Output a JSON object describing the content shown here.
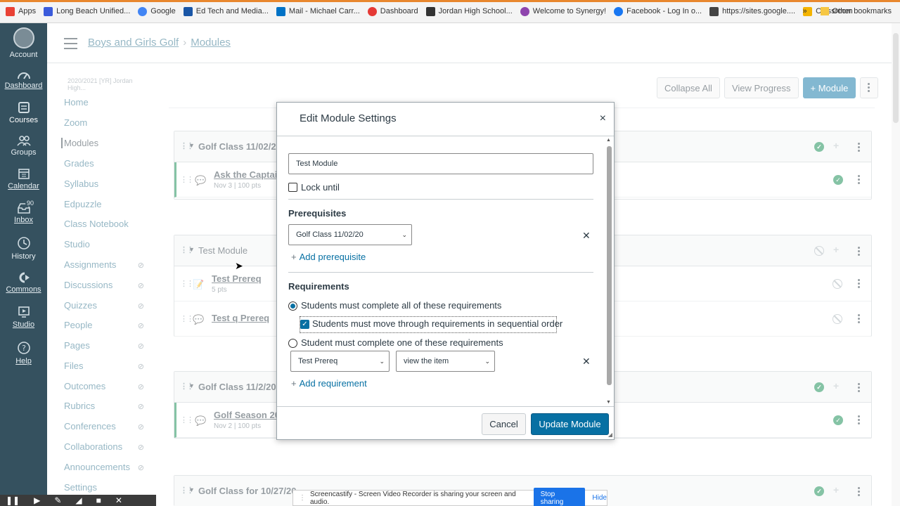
{
  "bookmarks": {
    "items": [
      {
        "label": "Apps",
        "color": "#e94235"
      },
      {
        "label": "Long Beach Unified...",
        "color": "#3b5bdb"
      },
      {
        "label": "Google",
        "color": "#4285f4"
      },
      {
        "label": "Ed Tech and Media...",
        "color": "#1a56a6"
      },
      {
        "label": "Mail - Michael Carr...",
        "color": "#0072c6"
      },
      {
        "label": "Dashboard",
        "color": "#e53935"
      },
      {
        "label": "Jordan High School...",
        "color": "#333333"
      },
      {
        "label": "Welcome to Synergy!",
        "color": "#8e44ad"
      },
      {
        "label": "Facebook - Log In o...",
        "color": "#1877f2"
      },
      {
        "label": "https://sites.google....",
        "color": "#444444"
      },
      {
        "label": "Classroom",
        "color": "#f4b400"
      }
    ],
    "more": "»",
    "other": "Other bookmarks"
  },
  "global_nav": {
    "items": [
      {
        "label": "Account"
      },
      {
        "label": "Dashboard"
      },
      {
        "label": "Courses"
      },
      {
        "label": "Groups"
      },
      {
        "label": "Calendar"
      },
      {
        "label": "Inbox",
        "badge": "90"
      },
      {
        "label": "History"
      },
      {
        "label": "Commons"
      },
      {
        "label": "Studio"
      },
      {
        "label": "Help"
      }
    ]
  },
  "breadcrumb": {
    "course": "Boys and Girls Golf",
    "page": "Modules"
  },
  "course_nav": {
    "term": "2020/2021 [YR] Jordan High...",
    "items": [
      {
        "label": "Home",
        "hidden": false
      },
      {
        "label": "Zoom",
        "hidden": false
      },
      {
        "label": "Modules",
        "hidden": false
      },
      {
        "label": "Grades",
        "hidden": false
      },
      {
        "label": "Syllabus",
        "hidden": false
      },
      {
        "label": "Edpuzzle",
        "hidden": false
      },
      {
        "label": "Class Notebook",
        "hidden": false
      },
      {
        "label": "Studio",
        "hidden": false
      },
      {
        "label": "Assignments",
        "hidden": true
      },
      {
        "label": "Discussions",
        "hidden": true
      },
      {
        "label": "Quizzes",
        "hidden": true
      },
      {
        "label": "People",
        "hidden": true
      },
      {
        "label": "Pages",
        "hidden": true
      },
      {
        "label": "Files",
        "hidden": true
      },
      {
        "label": "Outcomes",
        "hidden": true
      },
      {
        "label": "Rubrics",
        "hidden": true
      },
      {
        "label": "Conferences",
        "hidden": true
      },
      {
        "label": "Collaborations",
        "hidden": true
      },
      {
        "label": "Announcements",
        "hidden": true
      },
      {
        "label": "Settings",
        "hidden": false
      }
    ]
  },
  "toolbar": {
    "collapse_all": "Collapse All",
    "view_progress": "View Progress",
    "add_module": "+ Module"
  },
  "modules": [
    {
      "title": "Golf Class 11/02/20",
      "items": [
        {
          "title": "Ask the Captain",
          "meta": "Nov 3  |  100 pts"
        }
      ]
    },
    {
      "title": "Test Module",
      "items": [
        {
          "title": "Test Prereq",
          "meta": "5 pts"
        },
        {
          "title": "Test q Prereq",
          "meta": ""
        }
      ]
    },
    {
      "title": "Golf Class 11/2/20",
      "items": [
        {
          "title": "Golf Season 202",
          "meta": "Nov 2  |  100 pts"
        }
      ]
    },
    {
      "title": "Golf Class for 10/27/20",
      "items": []
    }
  ],
  "modal": {
    "title": "Edit Module Settings",
    "close": "×",
    "module_name": "Test Module",
    "lock_until": "Lock until",
    "prerequisites_title": "Prerequisites",
    "prerequisite_selected": "Golf Class 11/02/20",
    "add_prerequisite": "Add prerequisite",
    "requirements_title": "Requirements",
    "req_all": "Students must complete all of these requirements",
    "req_sequential": "Students must move through requirements in sequential order",
    "req_one": "Student must complete one of these requirements",
    "req_item_selected": "Test Prereq",
    "req_type_selected": "view the item",
    "add_requirement": "Add requirement",
    "cancel": "Cancel",
    "update": "Update Module"
  },
  "screencastify": {
    "message": "Screencastify - Screen Video Recorder is sharing your screen and audio.",
    "stop": "Stop sharing",
    "hide": "Hide"
  },
  "colors": {
    "nav_bg": "#35515f",
    "primary": "#0770a3",
    "success": "#0b874b",
    "link": "#2d6f8a"
  }
}
